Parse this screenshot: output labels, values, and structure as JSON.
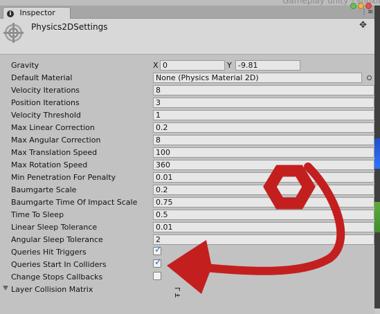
{
  "background_text": "Gameplay unity - shoxin",
  "tab": {
    "label": "Inspector"
  },
  "header": {
    "title": "Physics2DSettings"
  },
  "gravity": {
    "label": "Gravity",
    "x_label": "X",
    "x_value": "0",
    "y_label": "Y",
    "y_value": "-9.81"
  },
  "default_material": {
    "label": "Default Material",
    "value": "None (Physics Material 2D)"
  },
  "rows": [
    {
      "label": "Velocity Iterations",
      "value": "8"
    },
    {
      "label": "Position Iterations",
      "value": "3"
    },
    {
      "label": "Velocity Threshold",
      "value": "1"
    },
    {
      "label": "Max Linear Correction",
      "value": "0.2"
    },
    {
      "label": "Max Angular Correction",
      "value": "8"
    },
    {
      "label": "Max Translation Speed",
      "value": "100"
    },
    {
      "label": "Max Rotation Speed",
      "value": "360"
    },
    {
      "label": "Min Penetration For Penalty",
      "value": "0.01"
    },
    {
      "label": "Baumgarte Scale",
      "value": "0.2"
    },
    {
      "label": "Baumgarte Time Of Impact Scale",
      "value": "0.75"
    },
    {
      "label": "Time To Sleep",
      "value": "0.5"
    },
    {
      "label": "Linear Sleep Tolerance",
      "value": "0.01"
    },
    {
      "label": "Angular Sleep Tolerance",
      "value": "2"
    }
  ],
  "checkboxes": [
    {
      "label": "Queries Hit Triggers",
      "checked": true
    },
    {
      "label": "Queries Start In Colliders",
      "checked": true
    },
    {
      "label": "Change Stops Callbacks",
      "checked": false
    }
  ],
  "foldout": {
    "label": "Layer Collision Matrix"
  },
  "footer_text": "Ŧ ⅃",
  "colors": {
    "annotation_red": "#c41f1f"
  }
}
